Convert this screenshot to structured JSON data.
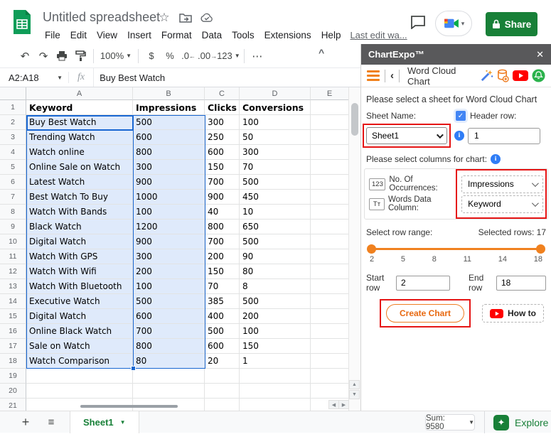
{
  "header": {
    "title": "Untitled spreadsheet",
    "star_icon": "☆",
    "menu": [
      "File",
      "Edit",
      "View",
      "Insert",
      "Format",
      "Data",
      "Tools",
      "Extensions",
      "Help"
    ],
    "last_edit": "Last edit wa...",
    "share_label": "Share"
  },
  "toolbar": {
    "undo": "↶",
    "redo": "↷",
    "zoom": "100%",
    "currency": "$",
    "percent": "%",
    "decrease_decimal": ".0",
    "increase_decimal": ".00",
    "number_format": "123",
    "more": "⋯",
    "collapse": "^"
  },
  "formula_bar": {
    "range": "A2:A18",
    "fx": "fx",
    "value": "Buy Best Watch"
  },
  "grid": {
    "column_letters": [
      "A",
      "B",
      "C",
      "D",
      "E"
    ],
    "headers": [
      "Keyword",
      "Impressions",
      "Clicks",
      "Conversions"
    ],
    "rows": [
      [
        "Buy Best Watch",
        "500",
        "300",
        "100"
      ],
      [
        "Trending Watch",
        "600",
        "250",
        "50"
      ],
      [
        "Watch online",
        "800",
        "600",
        "300"
      ],
      [
        "Online Sale on Watch",
        "300",
        "150",
        "70"
      ],
      [
        "Latest Watch",
        "900",
        "700",
        "500"
      ],
      [
        "Best Watch To Buy",
        "1000",
        "900",
        "450"
      ],
      [
        "Watch With Bands",
        "100",
        "40",
        "10"
      ],
      [
        "Black Watch",
        "1200",
        "800",
        "650"
      ],
      [
        "Digital Watch",
        "900",
        "700",
        "500"
      ],
      [
        "Watch With GPS",
        "300",
        "200",
        "90"
      ],
      [
        "Watch With Wifi",
        "200",
        "150",
        "80"
      ],
      [
        "Watch With Bluetooth",
        "100",
        "70",
        "8"
      ],
      [
        "Executive Watch",
        "500",
        "385",
        "500"
      ],
      [
        "Digital Watch",
        "600",
        "400",
        "200"
      ],
      [
        "Online Black Watch",
        "700",
        "500",
        "100"
      ],
      [
        "Sale on Watch",
        "800",
        "600",
        "150"
      ],
      [
        "Watch Comparison",
        "80",
        "20",
        "1"
      ]
    ]
  },
  "sidebar": {
    "app_title": "ChartExpo™",
    "close": "✕",
    "back": "‹",
    "chart_title": "Word Cloud Chart",
    "sheet_prompt": "Please select a sheet for Word Cloud Chart",
    "sheet_name_label": "Sheet Name:",
    "sheet_name_value": "Sheet1",
    "header_row_check": "✓",
    "header_row_label": "Header row:",
    "header_row_value": "1",
    "columns_prompt": "Please select columns for chart:",
    "occurrences_badge": "123",
    "occurrences_label": "No. Of Occurrences:",
    "occurrences_value": "Impressions",
    "words_badge": "Tт",
    "words_label": "Words Data Column:",
    "words_value": "Keyword",
    "row_range_label": "Select row range:",
    "selected_rows": "Selected rows: 17",
    "ticks": [
      "2",
      "5",
      "8",
      "11",
      "14",
      "18"
    ],
    "start_row_label": "Start row",
    "start_row_value": "2",
    "end_row_label": "End row",
    "end_row_value": "18",
    "create_chart_label": "Create Chart",
    "how_to_label": "How to",
    "info_glyph": "i"
  },
  "bottom_bar": {
    "add": "+",
    "all_sheets": "≡",
    "sheet_tab": "Sheet1",
    "sum": "Sum: 9580",
    "explore": "Explore",
    "explore_glyph": "✦"
  },
  "colors": {
    "accent_green": "#188038",
    "selection_blue": "#1967d2",
    "selection_fill": "#dfeafb",
    "chartexpo_orange": "#ee7d22",
    "annotation_red": "#e51414",
    "panel_header_gray": "#59595b"
  }
}
